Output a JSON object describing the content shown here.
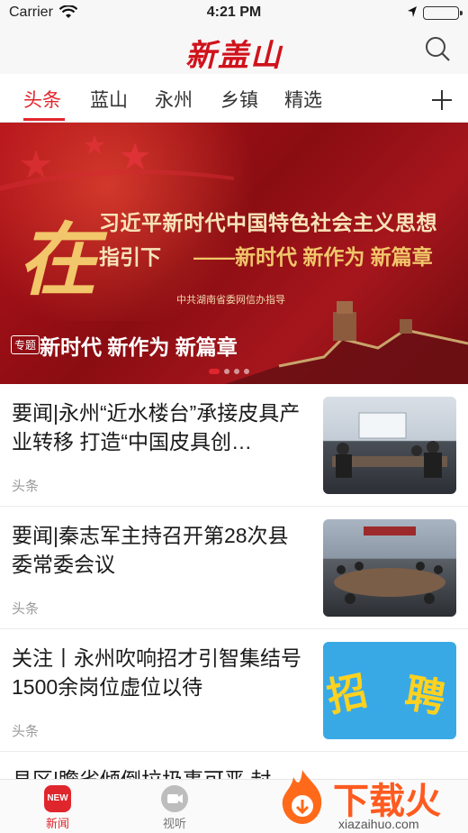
{
  "status_bar": {
    "carrier": "Carrier",
    "time": "4:21 PM"
  },
  "header": {
    "logo": "新盖山"
  },
  "tabs": [
    {
      "label": "头条",
      "active": true
    },
    {
      "label": "蓝山"
    },
    {
      "label": "永州"
    },
    {
      "label": "乡镇"
    },
    {
      "label": "精选"
    }
  ],
  "banner": {
    "big_char": "在",
    "line1": "习近平新时代中国特色社会主义思想",
    "line2_a": "指引下",
    "line2_b": "——新时代 新作为 新篇章",
    "guide": "中共湖南省委网信办指导",
    "topic_badge": "专题",
    "topic_title": "新时代 新作为 新篇章",
    "dots": 4,
    "active_dot": 0
  },
  "news": [
    {
      "title": "要闻|永州“近水楼台”承接皮具产业转移 打造“中国皮具创…",
      "source": "头条"
    },
    {
      "title": "要闻|秦志军主持召开第28次县委常委会议",
      "source": "头条"
    },
    {
      "title": "关注丨永州吹响招才引智集结号 1500余岗位虚位以待",
      "source": "头条",
      "thumb_text": [
        "招",
        "聘"
      ]
    }
  ],
  "partial_news_title": "县区|瞻省倾倒垃圾事可恶 封…",
  "bottom_bar": {
    "news_label": "新闻",
    "news_icon_text": "NEW",
    "listen_label": "视听"
  },
  "watermark": {
    "text": "下载火",
    "url": "xiazaihuo.com"
  },
  "colors": {
    "accent": "#e0262d",
    "banner_red": "#a5161c",
    "gold": "#f2c66a"
  }
}
